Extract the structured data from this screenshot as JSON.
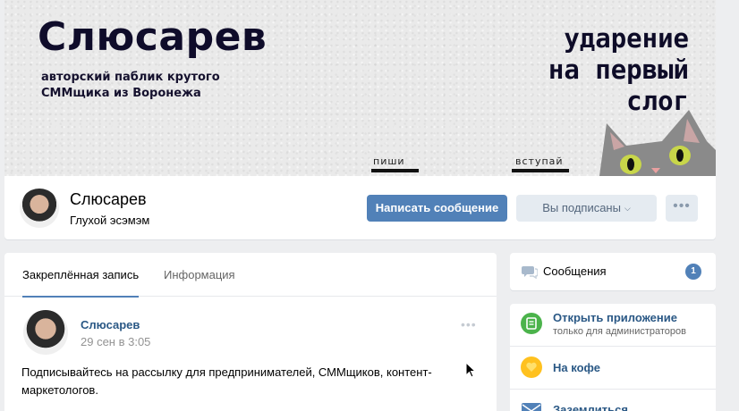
{
  "cover": {
    "title": "Слюсарев",
    "subtitle": "авторский паблик крутого СММщика из Воронежа",
    "right_text_line1": "ударение",
    "right_text_line2": "на первый",
    "right_text_line3": "слог",
    "label_write": "пиши",
    "label_join": "вступай"
  },
  "group": {
    "name": "Слюсарев",
    "status": "Глухой эсэмэм",
    "write_button": "Написать сообщение",
    "subscribed_button": "Вы подписаны",
    "more_button": "•••"
  },
  "tabs": [
    {
      "label": "Закреплённая запись"
    },
    {
      "label": "Информация"
    }
  ],
  "post": {
    "author": "Слюсарев",
    "date": "29 сен в 3:05",
    "menu": "•••",
    "text": "Подписывайтесь на рассылку для предпринимателей, СММщиков, контент-маркетологов."
  },
  "sidebar": {
    "messages_label": "Сообщения",
    "messages_count": "1",
    "app_title": "Открыть приложение",
    "app_subtitle": "только для администраторов",
    "coffee_label": "На кофе",
    "partial_label": "Заземлиться"
  },
  "colors": {
    "accent": "#5181b8",
    "link": "#2a5885",
    "background": "#edeef0",
    "app_icon": "#4bb34b",
    "coffee_icon": "#ffc11f"
  }
}
